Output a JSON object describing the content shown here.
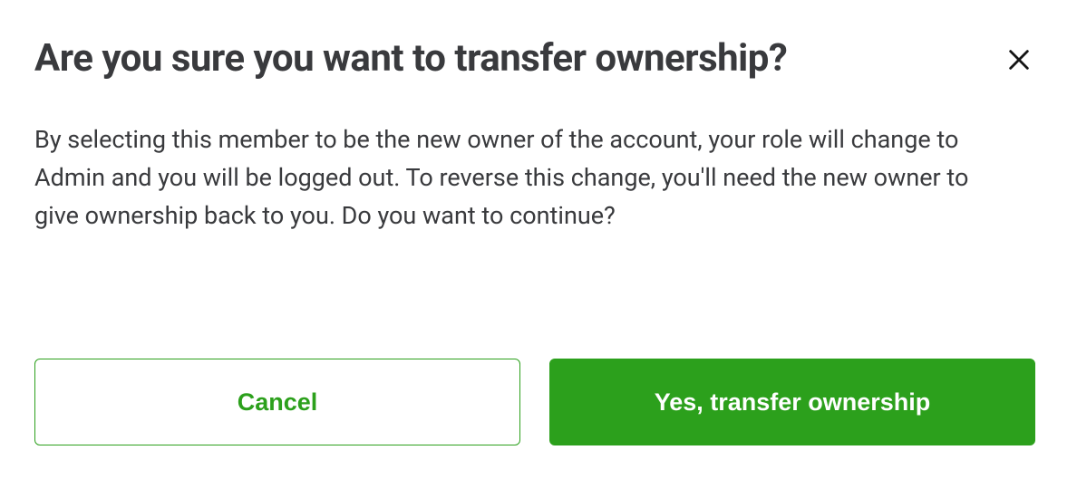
{
  "dialog": {
    "title": "Are you sure you want to transfer ownership?",
    "body": "By selecting this member to be the new owner of the account, your role will change to Admin and you will be logged out. To reverse this change, you'll need the new owner to give ownership back to you. Do you want to continue?",
    "cancel_label": "Cancel",
    "confirm_label": "Yes, transfer ownership"
  }
}
